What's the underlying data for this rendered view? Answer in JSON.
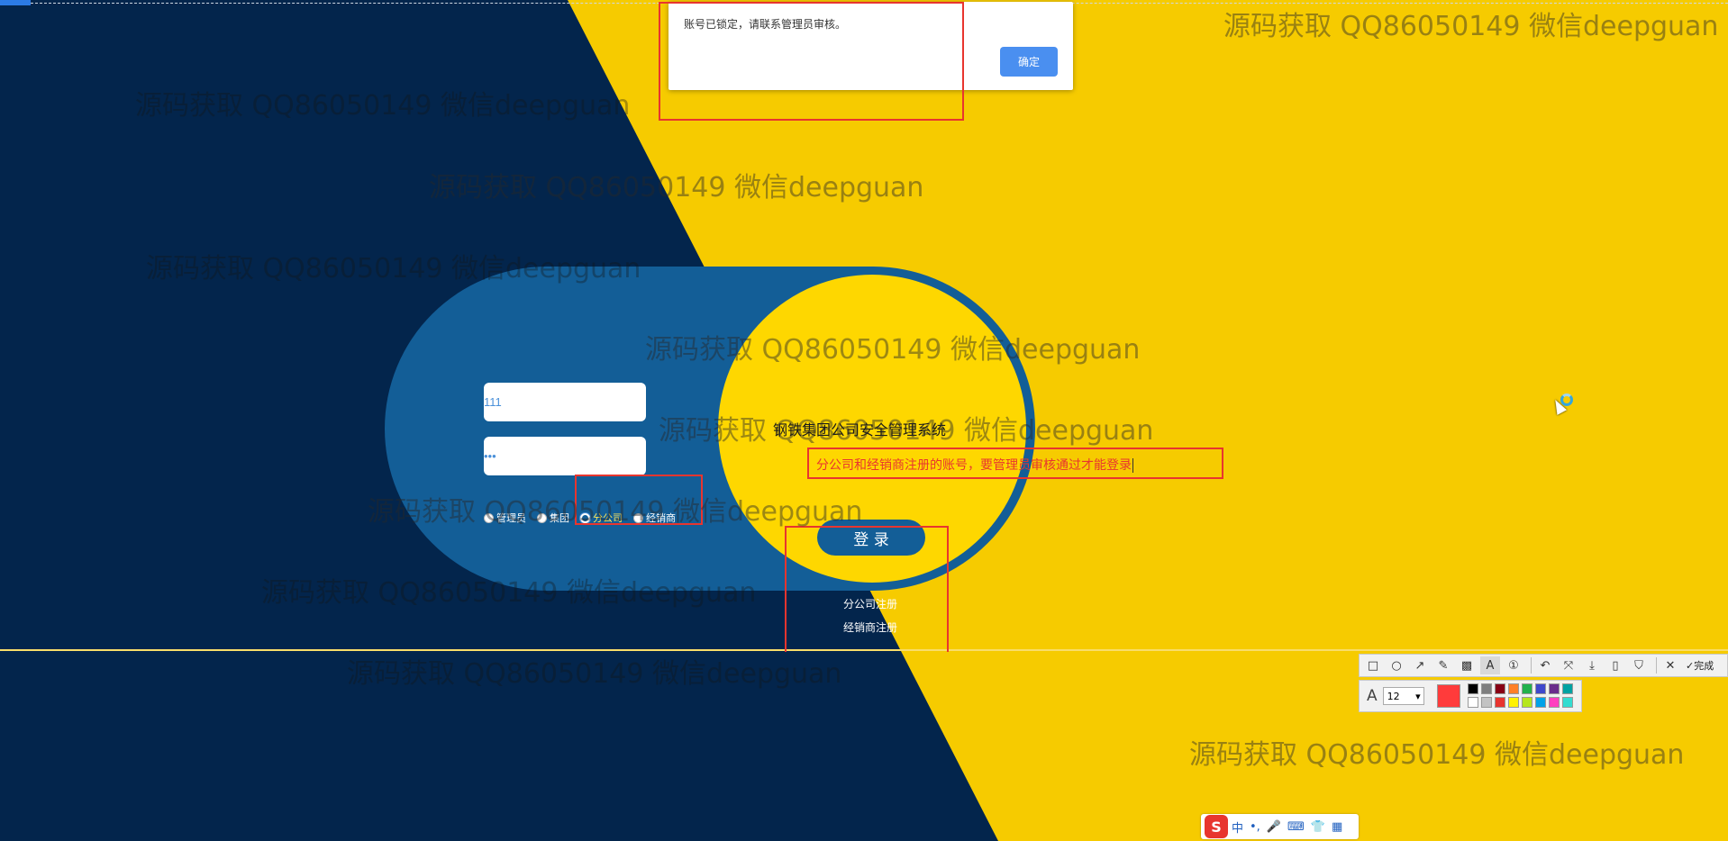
{
  "dialog": {
    "message": "账号已锁定，请联系管理员审核。",
    "confirm_label": "确定"
  },
  "login": {
    "username_value": "111",
    "password_value": "•••",
    "system_title": "钢铁集团公司安全管理系统",
    "roles": [
      {
        "label": "管理员",
        "checked": false
      },
      {
        "label": "集团",
        "checked": false
      },
      {
        "label": "分公司",
        "checked": true
      },
      {
        "label": "经销商",
        "checked": false
      }
    ],
    "login_button": "登 录",
    "register_branch": "分公司注册",
    "register_dealer": "经销商注册"
  },
  "annotation": {
    "note": "分公司和经销商注册的账号，要管理员审核通过才能登录"
  },
  "watermark": {
    "text": "源码获取 QQ86050149 微信deepguan"
  },
  "screenshot_tool": {
    "done_label": "完成",
    "font_size": "12",
    "current_color": "#ff3b3b",
    "palette": [
      "#000000",
      "#7f7f7f",
      "#880015",
      "#ff7f27",
      "#22b14c",
      "#3f48cc",
      "#6a2d8c",
      "#00a2a2",
      "#ffffff",
      "#c3c3c3",
      "#e8352f",
      "#fff200",
      "#b5e61d",
      "#00a2e8",
      "#ff3fbf",
      "#33dcd0"
    ]
  },
  "ime": {
    "logo": "S",
    "items": [
      "中",
      "•,",
      "🎤",
      "⌨",
      "👕",
      "▦"
    ]
  },
  "colors": {
    "navy": "#03254c",
    "yellow": "#f6cb00",
    "capsule_blue": "#135e97",
    "annotation_red": "#e8352f"
  }
}
